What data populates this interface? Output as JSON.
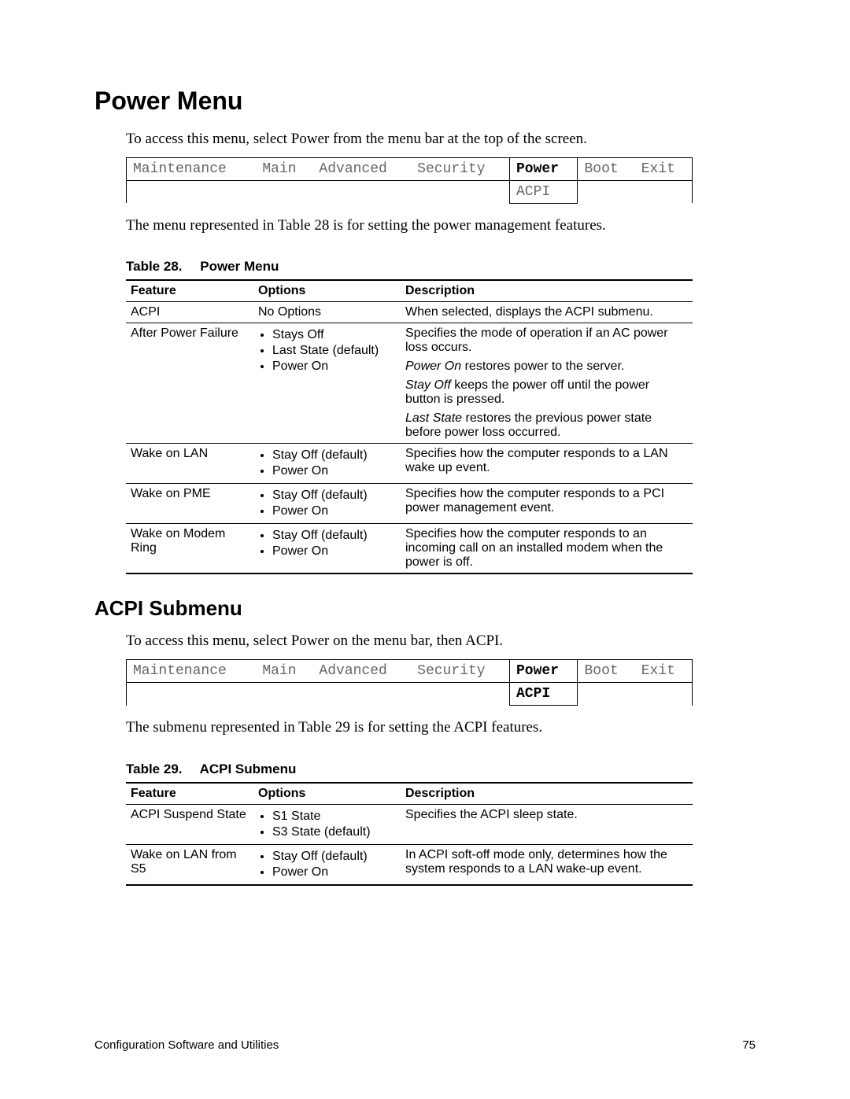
{
  "heading1": "Power Menu",
  "intro1": "To access this menu, select Power from the menu bar at the top of the screen.",
  "menubar1": {
    "items": [
      "Maintenance",
      "Main",
      "Advanced",
      "Security",
      "Power",
      "Boot",
      "Exit"
    ],
    "selected_index": 4,
    "sub": "ACPI"
  },
  "after_menubar1": "The menu represented in Table 28 is for setting the power management features.",
  "table28": {
    "caption_num": "Table 28.",
    "caption_title": "Power Menu",
    "headers": [
      "Feature",
      "Options",
      "Description"
    ],
    "rows": [
      {
        "feature": "ACPI",
        "options_plain": "No Options",
        "options": [],
        "desc": [
          {
            "pre": "",
            "text": "When selected, displays the ACPI submenu."
          }
        ]
      },
      {
        "feature": "After Power Failure",
        "options": [
          "Stays Off",
          "Last State (default)",
          "Power On"
        ],
        "desc": [
          {
            "pre": "",
            "text": "Specifies the mode of operation if an AC power loss occurs."
          },
          {
            "pre": "Power On",
            "text": " restores power to the server."
          },
          {
            "pre": "Stay Off",
            "text": " keeps the power off until the power button is pressed."
          },
          {
            "pre": "Last State",
            "text": " restores the previous power state before power loss occurred."
          }
        ]
      },
      {
        "feature": "Wake on LAN",
        "options": [
          "Stay Off (default)",
          "Power On"
        ],
        "desc": [
          {
            "pre": "",
            "text": "Specifies how the computer responds to a LAN wake up event."
          }
        ]
      },
      {
        "feature": "Wake on PME",
        "options": [
          "Stay Off (default)",
          "Power On"
        ],
        "desc": [
          {
            "pre": "",
            "text": "Specifies how the computer responds to a PCI power management event."
          }
        ]
      },
      {
        "feature": "Wake on Modem Ring",
        "options": [
          "Stay Off (default)",
          "Power On"
        ],
        "desc": [
          {
            "pre": "",
            "text": "Specifies how the computer responds to an incoming call on an installed modem when the power is off."
          }
        ]
      }
    ]
  },
  "heading2": "ACPI Submenu",
  "intro2": "To access this menu, select Power on the menu bar, then ACPI.",
  "menubar2": {
    "items": [
      "Maintenance",
      "Main",
      "Advanced",
      "Security",
      "Power",
      "Boot",
      "Exit"
    ],
    "selected_index": 4,
    "sub": "ACPI",
    "sub_bold": true
  },
  "after_menubar2": "The submenu represented in Table 29 is for setting the ACPI features.",
  "table29": {
    "caption_num": "Table 29.",
    "caption_title": "ACPI Submenu",
    "headers": [
      "Feature",
      "Options",
      "Description"
    ],
    "rows": [
      {
        "feature": "ACPI Suspend State",
        "options": [
          "S1 State",
          "S3 State (default)"
        ],
        "desc": [
          {
            "pre": "",
            "text": "Specifies the ACPI sleep state."
          }
        ]
      },
      {
        "feature": "Wake on LAN from S5",
        "options": [
          "Stay Off (default)",
          "Power On"
        ],
        "desc": [
          {
            "pre": "",
            "text": "In ACPI soft-off mode only, determines how the system responds to a LAN wake-up event."
          }
        ]
      }
    ]
  },
  "footer_left": "Configuration Software and Utilities",
  "footer_right": "75"
}
